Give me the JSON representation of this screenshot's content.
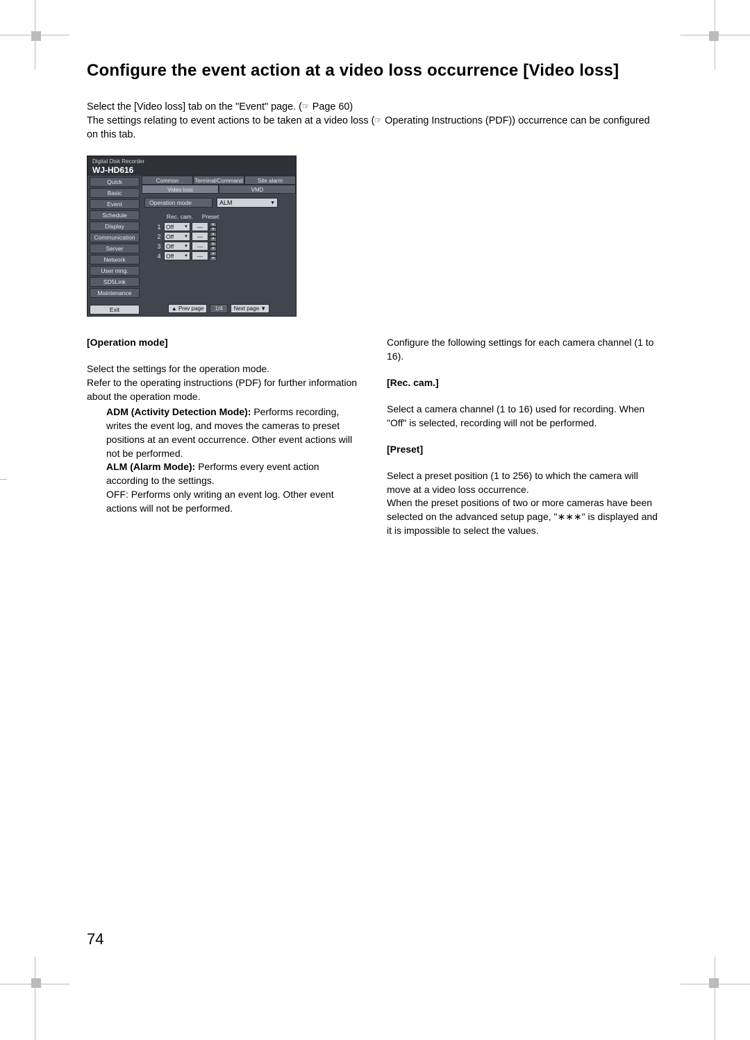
{
  "page_number": "74",
  "heading": "Configure the event action at a video loss occurrence [Video loss]",
  "intro_line1_a": "Select the [Video loss] tab on the \"Event\" page. (",
  "intro_line1_b": " Page 60)",
  "intro_line2_a": "The settings relating to event actions to be taken at a video loss (",
  "intro_line2_b": " Operating Instructions (PDF)) occurrence can be configured on this tab.",
  "ref_icon": "☞",
  "ui": {
    "brand_small": "Digital Disk Recorder",
    "model": "WJ-HD616",
    "sidebar": [
      "Quick",
      "Basic",
      "Event",
      "Schedule",
      "Display",
      "Communication",
      "Server",
      "Network",
      "User mng.",
      "SD5Link",
      "Maintenance"
    ],
    "exit_label": "Exit",
    "tabs_row1": [
      "Common",
      "Terminal/Command",
      "Site alarm"
    ],
    "tabs_row2": [
      "Video loss",
      "VMD"
    ],
    "opmode_label": "Operation mode",
    "opmode_value": "ALM",
    "col_headers": [
      "Rec. cam.",
      "Preset"
    ],
    "rows": [
      {
        "n": "1",
        "rec": "Off",
        "preset": "---"
      },
      {
        "n": "2",
        "rec": "Off",
        "preset": "---"
      },
      {
        "n": "3",
        "rec": "Off",
        "preset": "---"
      },
      {
        "n": "4",
        "rec": "Off",
        "preset": "---"
      }
    ],
    "prev": "▲ Prev page",
    "page": "1/4",
    "next": "Next page ▼"
  },
  "left_col": {
    "h1": "[Operation mode]",
    "p1": "Select the settings for the operation mode.",
    "p2": "Refer to the operating instructions (PDF) for further information about the operation mode.",
    "adm_label": "ADM (Activity Detection Mode):",
    "adm_text": " Performs recording, writes the event log, and moves the cameras to preset positions at an event occurrence. Other event actions will not be performed.",
    "alm_label": "ALM (Alarm Mode):",
    "alm_text": " Performs every event action according to the settings.",
    "off_text": "OFF: Performs only writing an event log. Other event actions will not be performed."
  },
  "right_col": {
    "intro": "Configure the following settings for each camera channel (1 to 16).",
    "h1": "[Rec. cam.]",
    "p1": "Select a camera channel (1 to 16) used for recording. When \"Off\" is selected, recording will not be performed.",
    "h2": "[Preset]",
    "p2": "Select a preset position (1 to 256) to which the camera will move at a video loss occurrence.",
    "p3": "When the preset positions of two or more cameras have been selected on the advanced setup page, \"∗∗∗\" is displayed and it is impossible to select the values."
  }
}
